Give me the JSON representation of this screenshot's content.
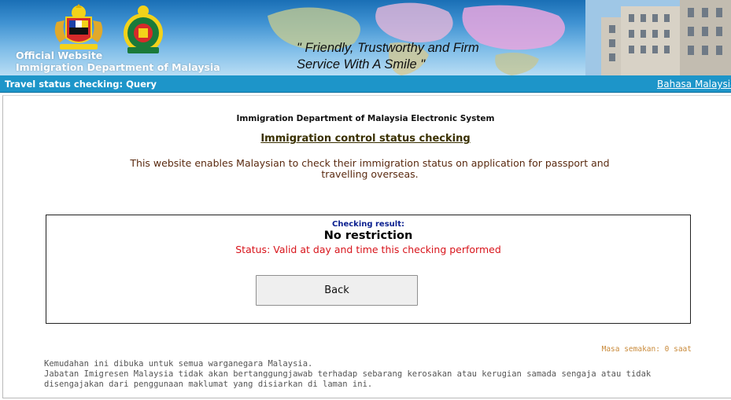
{
  "banner": {
    "official_line1": "Official Website",
    "official_line2": "Immigration Department of Malaysia",
    "slogan_line1": "\" Friendly, Trustworthy and Firm",
    "slogan_line2": "Service With A Smile \""
  },
  "nav": {
    "title": "Travel status checking: Query",
    "language_link": "Bahasa Malaysia"
  },
  "main": {
    "system_name": "Immigration Department of Malaysia Electronic System",
    "heading": "Immigration control status checking",
    "intro": "This website enables Malaysian to check their immigration status on application for passport and travelling overseas."
  },
  "result": {
    "label": "Checking result:",
    "value": "No restriction",
    "status": "Status: Valid at day and time this checking performed",
    "back_label": "Back"
  },
  "timer": "Masa semakan: 0 saat",
  "footer": {
    "line1": "Kemudahan ini dibuka untuk semua warganegara Malaysia.",
    "line2": "Jabatan Imigresen Malaysia tidak akan bertanggungjawab terhadap sebarang kerosakan atau kerugian samada sengaja atau tidak",
    "line3": "disengajakan dari penggunaan maklumat yang disiarkan di laman ini."
  },
  "colors": {
    "nav_bar": "#1d95c9",
    "status_text": "#d8141b",
    "result_label": "#0a1f8f",
    "timer_text": "#c98a3a"
  }
}
